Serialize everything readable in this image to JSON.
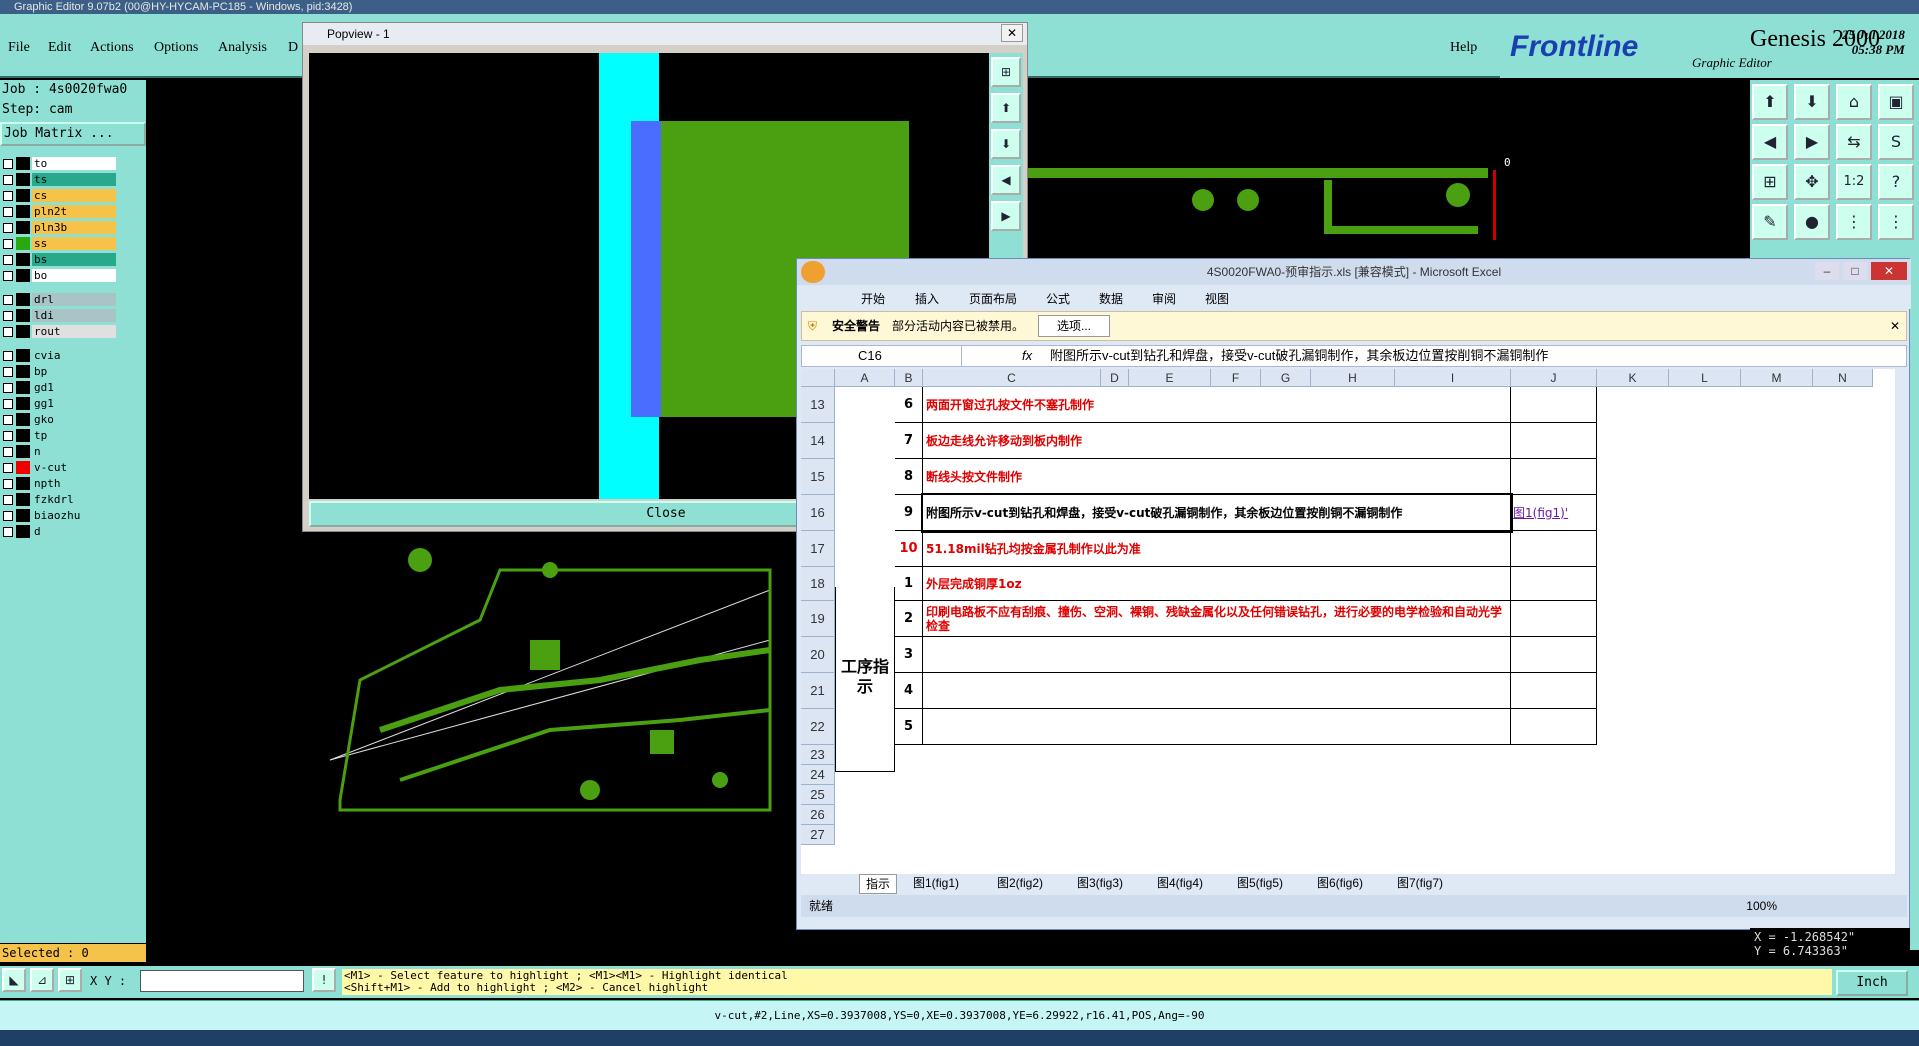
{
  "window_title": "Graphic Editor 9.07b2 (00@HY-HYCAM-PC185 - Windows, pid:3428)",
  "menu": [
    "File",
    "Edit",
    "Actions",
    "Options",
    "Analysis",
    "D"
  ],
  "help_label": "Help",
  "brand": {
    "logo": "Frontline",
    "product": "Genesis 2000",
    "subtitle": "Graphic Editor",
    "date": "25 Jul 2018",
    "time": "05:38 PM"
  },
  "job_label": "Job : 4s0020fwa0",
  "step_label": "Step: cam",
  "job_matrix_label": "Job Matrix ...",
  "layers": [
    {
      "name": "to",
      "color": "#ffffff"
    },
    {
      "name": "ts",
      "color": "#2aa88c"
    },
    {
      "name": "cs",
      "color": "#f5c24a"
    },
    {
      "name": "pln2t",
      "color": "#f5c24a"
    },
    {
      "name": "pln3b",
      "color": "#f5c24a"
    },
    {
      "name": "ss",
      "color": "#f5c24a"
    },
    {
      "name": "bs",
      "color": "#2aa88c"
    },
    {
      "name": "bo",
      "color": "#ffffff"
    },
    {
      "name": "drl",
      "color": "#a8c4c4"
    },
    {
      "name": "ldi",
      "color": "#a8c4c4"
    },
    {
      "name": "rout",
      "color": "#e0e0e0"
    },
    {
      "name": "cvia",
      "color": "#8fe0d4"
    },
    {
      "name": "bp",
      "color": "#8fe0d4"
    },
    {
      "name": "gd1",
      "color": "#8fe0d4"
    },
    {
      "name": "gg1",
      "color": "#8fe0d4"
    },
    {
      "name": "gko",
      "color": "#8fe0d4"
    },
    {
      "name": "tp",
      "color": "#8fe0d4"
    },
    {
      "name": "n",
      "color": "#8fe0d4"
    },
    {
      "name": "v-cut",
      "color": "#8fe0d4"
    },
    {
      "name": "npth",
      "color": "#8fe0d4"
    },
    {
      "name": "fzkdrl",
      "color": "#8fe0d4"
    },
    {
      "name": "biaozhu",
      "color": "#8fe0d4"
    },
    {
      "name": "d",
      "color": "#8fe0d4"
    }
  ],
  "selected_label": "Selected : 0",
  "xy_label": "X Y :",
  "xy_value": "",
  "hint_line1": "<M1> - Select feature to highlight ; <M1><M1> - Highlight identical",
  "hint_line2": "<Shift+M1> - Add to highlight ; <M2> - Cancel highlight",
  "status_text": "v-cut,#2,Line,XS=0.3937008,YS=0,XE=0.3937008,YE=6.29922,r16.41,POS,Ang=-90",
  "coords": {
    "x": "X = -1.268542\"",
    "y": "Y = 6.743363\""
  },
  "units_label": "Inch",
  "canvas_zero": "0",
  "popview": {
    "title": "Popview - 1",
    "close_label": "Close"
  },
  "excel": {
    "title": "4S0020FWA0-预审指示.xls [兼容模式] - Microsoft Excel",
    "ribbon_tabs": [
      "开始",
      "插入",
      "页面布局",
      "公式",
      "数据",
      "审阅",
      "视图"
    ],
    "security_title": "安全警告",
    "security_text": "部分活动内容已被禁用。",
    "options_label": "选项...",
    "name_box": "C16",
    "formula": "附图所示v-cut到钻孔和焊盘，接受v-cut破孔漏铜制作，其余板边位置按削铜不漏铜制作",
    "columns": [
      "A",
      "B",
      "C",
      "D",
      "E",
      "F",
      "G",
      "H",
      "I",
      "J",
      "K",
      "L",
      "M",
      "N"
    ],
    "rows": [
      {
        "num": "13",
        "b": "6",
        "c": "两面开窗过孔按文件不塞孔制作",
        "red": true
      },
      {
        "num": "14",
        "b": "7",
        "c": "板边走线允许移动到板内制作",
        "red": true
      },
      {
        "num": "15",
        "b": "8",
        "c": "断线头按文件制作",
        "red": true
      },
      {
        "num": "16",
        "b": "9",
        "c": "附图所示v-cut到钻孔和焊盘，接受v-cut破孔漏铜制作，其余板边位置按削铜不漏铜制作",
        "red": false,
        "j": "图1(fig1)'"
      },
      {
        "num": "17",
        "b": "10",
        "c": "51.18mil钻孔均按金属孔制作以此为准",
        "red": true
      },
      {
        "num": "18",
        "b": "1",
        "c": "外层完成铜厚1oz",
        "red": true
      },
      {
        "num": "19",
        "b": "2",
        "c": "印刷电路板不应有刮痕、撞伤、空洞、裸铜、残缺金属化以及任何错误钻孔，进行必要的电学检验和自动光学检查",
        "red": true
      },
      {
        "num": "20",
        "b": "3",
        "c": "",
        "red": false
      },
      {
        "num": "21",
        "b": "4",
        "c": "",
        "red": false
      },
      {
        "num": "22",
        "b": "5",
        "c": "",
        "red": false
      },
      {
        "num": "23"
      },
      {
        "num": "24"
      },
      {
        "num": "25"
      },
      {
        "num": "26"
      },
      {
        "num": "27"
      }
    ],
    "section_label": "工序指示",
    "sheet_tabs": [
      "指示",
      "图1(fig1)",
      "图2(fig2)",
      "图3(fig3)",
      "图4(fig4)",
      "图5(fig5)",
      "图6(fig6)",
      "图7(fig7)"
    ],
    "status_ready": "就绪",
    "zoom": "100%"
  }
}
